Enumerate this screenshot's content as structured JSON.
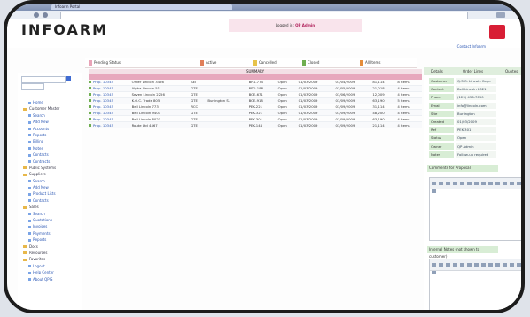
{
  "browser": {
    "tab_title": "Infoarm Portal",
    "address": ""
  },
  "app": {
    "logo_text": "INFOARM",
    "login_text": "Logged in:",
    "login_user": "QP Admin",
    "help_link": "Contact Infoarm",
    "colors": {
      "accent": "#e7a8bd",
      "brand_red": "#d81e35",
      "panel_green": "#d8edd5",
      "link_blue": "#2a56b3"
    }
  },
  "filters": [
    {
      "label": "Pending Status",
      "color": "#e8a3b7"
    },
    {
      "label": "Active",
      "color": "#e07f5a"
    },
    {
      "label": "Cancelled",
      "color": "#e7c34a"
    },
    {
      "label": "Closed",
      "color": "#6fae4f"
    },
    {
      "label": "All Items",
      "color": "#e58d3a"
    }
  ],
  "sidebar": {
    "items": [
      {
        "label": "Home",
        "kind": "sub"
      },
      {
        "label": "Customer Master",
        "kind": "folder"
      },
      {
        "label": "Search",
        "kind": "sub"
      },
      {
        "label": "Add New",
        "kind": "sub"
      },
      {
        "label": "Accounts",
        "kind": "sub"
      },
      {
        "label": "Reports",
        "kind": "sub"
      },
      {
        "label": "Billing",
        "kind": "sub"
      },
      {
        "label": "Notes",
        "kind": "sub"
      },
      {
        "label": "Contacts",
        "kind": "sub"
      },
      {
        "label": "Contracts",
        "kind": "sub"
      },
      {
        "label": "Public Systems",
        "kind": "folder"
      },
      {
        "label": "Suppliers",
        "kind": "folder"
      },
      {
        "label": "Search",
        "kind": "sub"
      },
      {
        "label": "Add New",
        "kind": "sub"
      },
      {
        "label": "Product Lists",
        "kind": "sub"
      },
      {
        "label": "Contacts",
        "kind": "sub"
      },
      {
        "label": "Sales",
        "kind": "folder"
      },
      {
        "label": "Search",
        "kind": "sub"
      },
      {
        "label": "Quotations",
        "kind": "sub"
      },
      {
        "label": "Invoices",
        "kind": "sub"
      },
      {
        "label": "Payments",
        "kind": "sub"
      },
      {
        "label": "Reports",
        "kind": "sub"
      },
      {
        "label": "Docs",
        "kind": "folder"
      },
      {
        "label": "Resources",
        "kind": "folder"
      },
      {
        "label": "Favorites",
        "kind": "folder"
      },
      {
        "label": "Logout",
        "kind": "sub"
      },
      {
        "label": "Help Center",
        "kind": "sub"
      },
      {
        "label": "About QPIS",
        "kind": "sub"
      }
    ]
  },
  "grid": {
    "title": "SUMMARY",
    "rows": [
      [
        "Prop. 10345",
        "Order Lincoln 3456",
        "SEI",
        "",
        "BR1-774",
        "Open",
        "01/03/2009",
        "01/04/2009",
        "81,114",
        "8 Items"
      ],
      [
        "Prop. 10345",
        "Alpha Lincoln 51",
        "GTE",
        "",
        "PSO-188",
        "Open",
        "01/03/2009",
        "01/05/2009",
        "21,018",
        "4 Items"
      ],
      [
        "Prop. 10345",
        "Seven Lincoln 2256",
        "GTE",
        "",
        "BCE-671",
        "Open",
        "01/03/2009",
        "01/06/2009",
        "12,009",
        "4 Items"
      ],
      [
        "Prop. 10345",
        "K.O.C. Trade 805",
        "GTE",
        "Burlington S.",
        "BCE-918",
        "Open",
        "01/03/2009",
        "01/09/2009",
        "63,190",
        "5 Items"
      ],
      [
        "Prop. 10345",
        "Bell Lincoln 773",
        "RCC",
        "",
        "PEK-221",
        "Open",
        "01/03/2009",
        "01/09/2009",
        "31,114",
        "4 Items"
      ],
      [
        "Prop. 10345",
        "Bell Lincoln 9401",
        "GTE",
        "",
        "PEK-321",
        "Open",
        "01/03/2009",
        "01/09/2009",
        "48,200",
        "4 Items"
      ],
      [
        "Prop. 10345",
        "Bell Lincoln 8021",
        "GTE",
        "",
        "PEK-301",
        "Open",
        "01/03/2009",
        "01/09/2009",
        "63,190",
        "4 Items"
      ],
      [
        "Prop. 10345",
        "Route Ltd 4467",
        "GTE",
        "",
        "PEK-144",
        "Open",
        "01/03/2009",
        "01/09/2009",
        "21,114",
        "4 Items"
      ]
    ]
  },
  "details": {
    "tabs": [
      "Details",
      "Order Lines",
      "Quotes"
    ],
    "fields": [
      {
        "label": "Customer",
        "value": "Q.S.O. Lincoln Corp."
      },
      {
        "label": "Contact",
        "value": "Bell Lincoln 8021"
      },
      {
        "label": "Phone",
        "value": "(123) 456-7890"
      },
      {
        "label": "Email",
        "value": "info@lincoln.com"
      },
      {
        "label": "Site",
        "value": "Burlington"
      },
      {
        "label": "Created",
        "value": "01/03/2009"
      },
      {
        "label": "Ref",
        "value": "PEK-301"
      },
      {
        "label": "Status",
        "value": "Open"
      },
      {
        "label": "Owner",
        "value": "QP Admin"
      },
      {
        "label": "Notes",
        "value": "Follow-up required"
      }
    ],
    "section1": "Comments for Proposal",
    "section2": "Internal Notes (not shown to customer)"
  }
}
